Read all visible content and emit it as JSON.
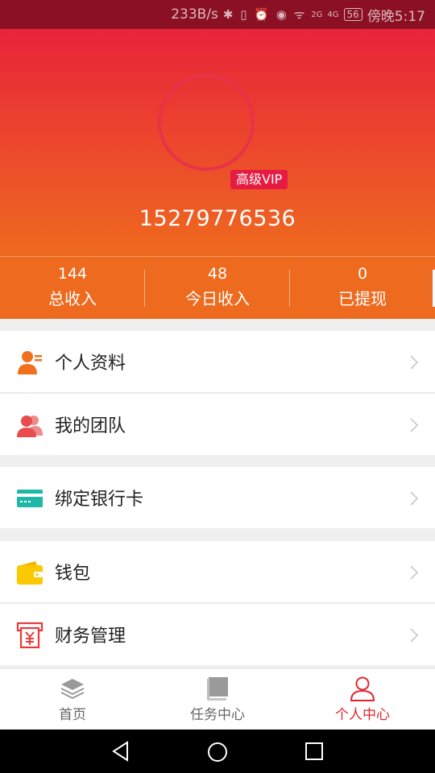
{
  "status_bar": {
    "speed": "233B/s",
    "icons": "✱ ▯ ⏰ ◉ ᯤ",
    "signal_1": "2G",
    "signal_2": "4G",
    "battery": "56",
    "time": "傍晚5:17"
  },
  "profile": {
    "vip_badge": "高级VIP",
    "phone": "15279776536"
  },
  "stats": [
    {
      "value": "144",
      "label": "总收入"
    },
    {
      "value": "48",
      "label": "今日收入"
    },
    {
      "value": "0",
      "label": "已提现"
    }
  ],
  "menu": [
    {
      "label": "个人资料",
      "icon": "user-card-icon"
    },
    {
      "label": "我的团队",
      "icon": "team-icon"
    },
    {
      "label": "绑定银行卡",
      "icon": "bank-card-icon"
    },
    {
      "label": "钱包",
      "icon": "wallet-icon"
    },
    {
      "label": "财务管理",
      "icon": "finance-icon"
    }
  ],
  "bottom_nav": [
    {
      "label": "首页",
      "icon": "layers-icon"
    },
    {
      "label": "任务中心",
      "icon": "book-icon"
    },
    {
      "label": "个人中心",
      "icon": "person-icon",
      "active": true
    }
  ],
  "colors": {
    "header_top": "#e8243a",
    "header_bottom": "#ee6a1e",
    "accent": "#e4252e"
  }
}
